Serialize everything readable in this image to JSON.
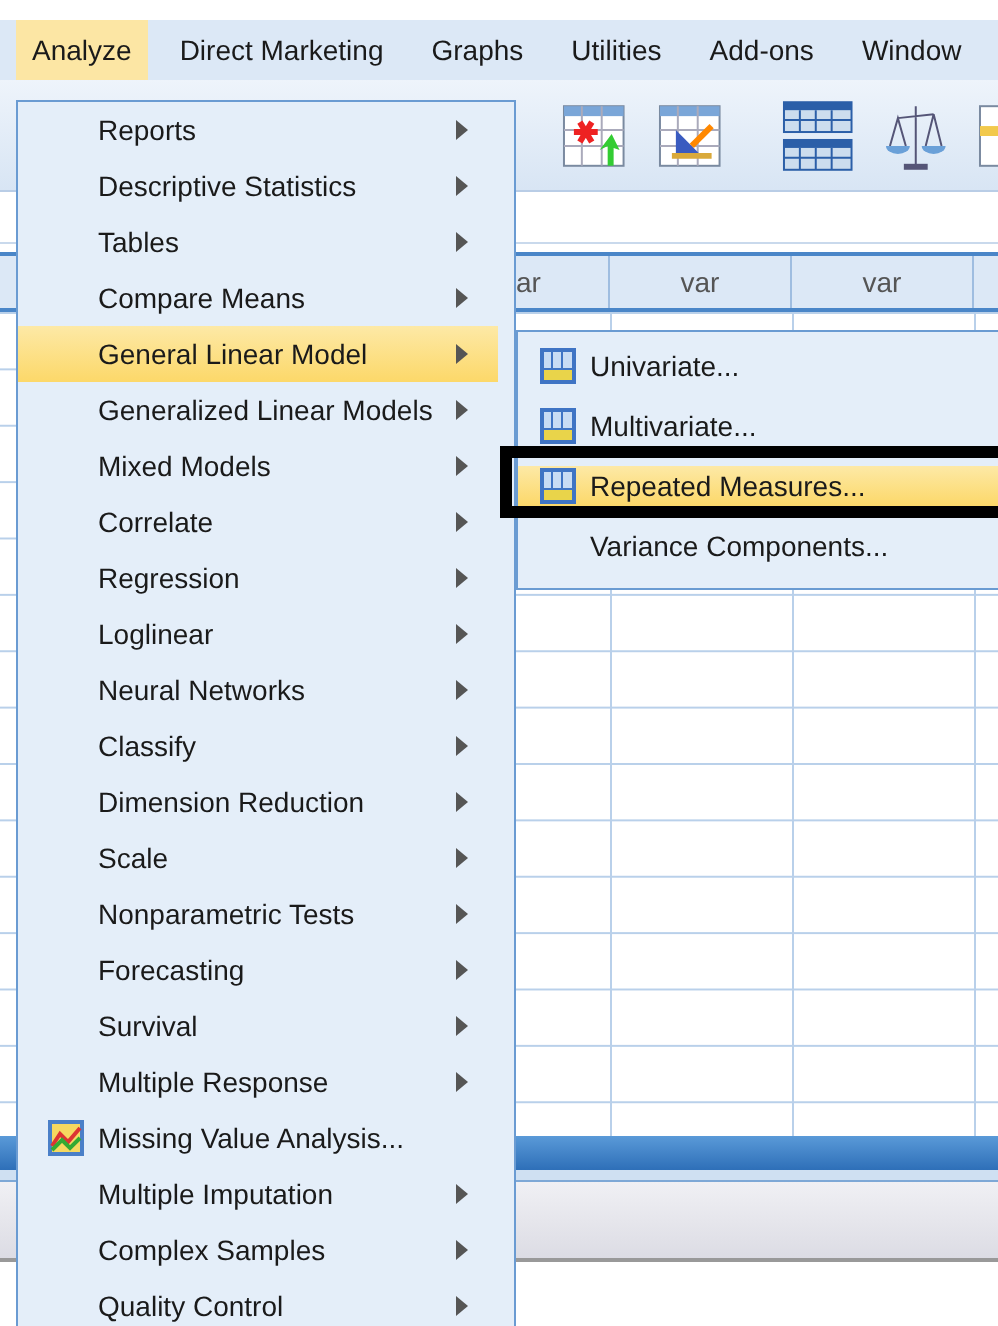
{
  "menubar": [
    {
      "label": "Analyze",
      "selected": true
    },
    {
      "label": "Direct Marketing",
      "selected": false
    },
    {
      "label": "Graphs",
      "selected": false
    },
    {
      "label": "Utilities",
      "selected": false
    },
    {
      "label": "Add-ons",
      "selected": false
    },
    {
      "label": "Window",
      "selected": false
    }
  ],
  "grid": {
    "columns": [
      "ar",
      "var",
      "var"
    ]
  },
  "menu": {
    "items": [
      {
        "label": "Reports",
        "submenu": true,
        "selected": false,
        "icon": false
      },
      {
        "label": "Descriptive Statistics",
        "submenu": true,
        "selected": false,
        "icon": false
      },
      {
        "label": "Tables",
        "submenu": true,
        "selected": false,
        "icon": false
      },
      {
        "label": "Compare Means",
        "submenu": true,
        "selected": false,
        "icon": false
      },
      {
        "label": "General Linear Model",
        "submenu": true,
        "selected": true,
        "icon": false
      },
      {
        "label": "Generalized Linear Models",
        "submenu": true,
        "selected": false,
        "icon": false
      },
      {
        "label": "Mixed Models",
        "submenu": true,
        "selected": false,
        "icon": false
      },
      {
        "label": "Correlate",
        "submenu": true,
        "selected": false,
        "icon": false
      },
      {
        "label": "Regression",
        "submenu": true,
        "selected": false,
        "icon": false
      },
      {
        "label": "Loglinear",
        "submenu": true,
        "selected": false,
        "icon": false
      },
      {
        "label": "Neural Networks",
        "submenu": true,
        "selected": false,
        "icon": false
      },
      {
        "label": "Classify",
        "submenu": true,
        "selected": false,
        "icon": false
      },
      {
        "label": "Dimension Reduction",
        "submenu": true,
        "selected": false,
        "icon": false
      },
      {
        "label": "Scale",
        "submenu": true,
        "selected": false,
        "icon": false
      },
      {
        "label": "Nonparametric Tests",
        "submenu": true,
        "selected": false,
        "icon": false
      },
      {
        "label": "Forecasting",
        "submenu": true,
        "selected": false,
        "icon": false
      },
      {
        "label": "Survival",
        "submenu": true,
        "selected": false,
        "icon": false
      },
      {
        "label": "Multiple Response",
        "submenu": true,
        "selected": false,
        "icon": false
      },
      {
        "label": "Missing Value Analysis...",
        "submenu": false,
        "selected": false,
        "icon": true
      },
      {
        "label": "Multiple Imputation",
        "submenu": true,
        "selected": false,
        "icon": false
      },
      {
        "label": "Complex Samples",
        "submenu": true,
        "selected": false,
        "icon": false
      },
      {
        "label": "Quality Control",
        "submenu": true,
        "selected": false,
        "icon": false
      }
    ]
  },
  "submenu": {
    "items": [
      {
        "label": "Univariate...",
        "selected": false,
        "icon": true,
        "annotated": false
      },
      {
        "label": "Multivariate...",
        "selected": false,
        "icon": true,
        "annotated": false
      },
      {
        "label": "Repeated Measures...",
        "selected": true,
        "icon": true,
        "annotated": true
      },
      {
        "label": "Variance Components...",
        "selected": false,
        "icon": false,
        "annotated": false
      }
    ]
  }
}
